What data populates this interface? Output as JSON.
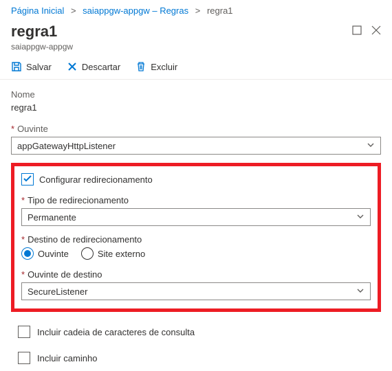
{
  "breadcrumb": {
    "home": "Página Inicial",
    "mid": "saiappgw-appgw – Regras",
    "current": "regra1"
  },
  "header": {
    "title": "regra1",
    "subtitle": "saiappgw-appgw"
  },
  "toolbar": {
    "save": "Salvar",
    "discard": "Descartar",
    "delete": "Excluir"
  },
  "form": {
    "nome_label": "Nome",
    "nome_value": "regra1",
    "ouvinte_label": "Ouvinte",
    "ouvinte_value": "appGatewayHttpListener",
    "config_redirect_label": "Configurar redirecionamento",
    "tipo_redirect_label": "Tipo de redirecionamento",
    "tipo_redirect_value": "Permanente",
    "destino_redirect_label": "Destino de redirecionamento",
    "destino_opt_ouvinte": "Ouvinte",
    "destino_opt_site": "Site externo",
    "ouvinte_destino_label": "Ouvinte de destino",
    "ouvinte_destino_value": "SecureListener",
    "incluir_query_label": "Incluir cadeia de caracteres de consulta",
    "incluir_caminho_label": "Incluir caminho"
  }
}
